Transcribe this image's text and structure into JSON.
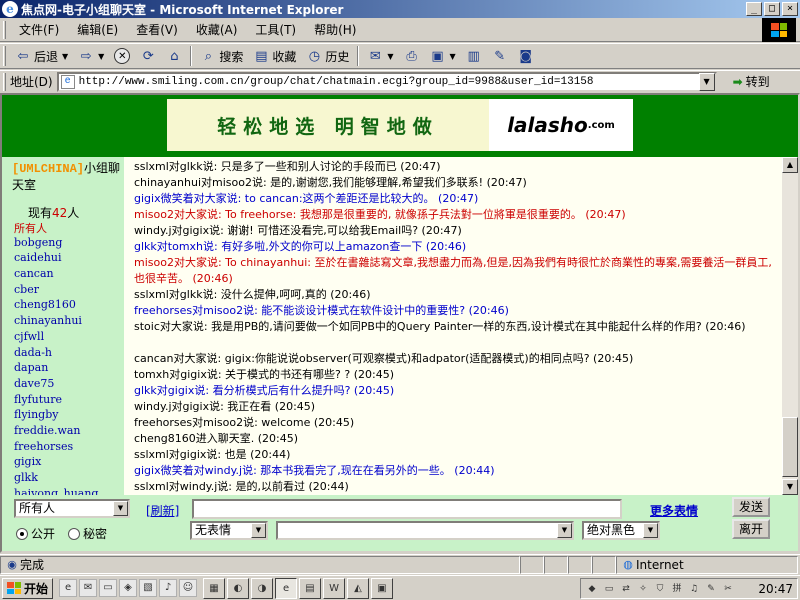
{
  "window": {
    "title": "焦点网-电子小组聊天室 - Microsoft Internet Explorer",
    "icon": "ie-icon",
    "controls": [
      "_",
      "□",
      "×"
    ]
  },
  "menu": [
    "文件(F)",
    "编辑(E)",
    "查看(V)",
    "收藏(A)",
    "工具(T)",
    "帮助(H)"
  ],
  "toolbar": {
    "back": "后退",
    "search": "搜索",
    "favorites": "收藏",
    "history": "历史"
  },
  "address": {
    "label": "地址(D)",
    "url": "http://www.smiling.com.cn/group/chat/chatmain.ecgi?group_id=9988&user_id=13158",
    "go": "转到"
  },
  "banner": {
    "slogan": "轻松地选 明智地做",
    "logo_main": "lalasho",
    "logo_suffix": ".com"
  },
  "room": {
    "brand": "[UMLCHINA]",
    "title_rest": "小组聊天室",
    "online_prefix": "现有",
    "online_count": "42",
    "online_suffix": "人"
  },
  "users": [
    "所有人",
    "bobgeng",
    "caidehui",
    "cancan",
    "cber",
    "cheng8160",
    "chinayanhui",
    "cjfwll",
    "dada-h",
    "dapan",
    "dave75",
    "flyfuture",
    "flyingby",
    "freddie.wan",
    "freehorses",
    "gigix",
    "glkk",
    "haiyong_huang"
  ],
  "colors": {
    "normal": "#000000",
    "blue": "#0000cc",
    "red": "#cc0000"
  },
  "messages": [
    {
      "text": "sslxml对glkk说: 只是多了一些和别人讨论的手段而已 (20:47)",
      "color": "normal"
    },
    {
      "text": "chinayanhui对misoo2说: 是的,谢谢您,我们能够理解,希望我们多联系!  (20:47)",
      "color": "normal"
    },
    {
      "text": "gigix微笑着对大家说: to cancan:这两个差距还是比较大的。 (20:47)",
      "color": "blue"
    },
    {
      "text": "misoo2对大家说: To freehorse: 我想那是很重要的, 就像孫子兵法對一位將軍是很重要的。 (20:47)",
      "color": "red"
    },
    {
      "text": "windy.j对gigix说: 谢谢! 可惜还没看完,可以给我Email吗? (20:47)",
      "color": "normal"
    },
    {
      "text": "glkk对tomxh说: 有好多啦,外文的你可以上amazon查一下 (20:46)",
      "color": "blue"
    },
    {
      "text": "misoo2对大家说: To chinayanhui: 至於在書雜誌寫文章,我想盡力而為,但是,因為我們有時很忙於商業性的專案,需要養活一群員工,也很辛苦。 (20:46)",
      "color": "red",
      "wrap": true
    },
    {
      "text": "sslxml对glkk说: 没什么提伸,呵呵,真的 (20:46)",
      "color": "normal"
    },
    {
      "text": "freehorses对misoo2说: 能不能谈设计模式在软件设计中的重要性? (20:46)",
      "color": "blue"
    },
    {
      "text": "stoic对大家说: 我是用PB的,请问要做一个如同PB中的Query Painter一样的东西,设计模式在其中能起什么样的作用? (20:46)",
      "color": "normal",
      "wrap": true
    },
    {
      "text": "cancan对大家说: gigix:你能说说observer(可观察模式)和adpator(适配器模式)的相同点吗? (20:45)",
      "color": "normal"
    },
    {
      "text": "tomxh对gigix说: 关于模式的书还有哪些? ? (20:45)",
      "color": "normal"
    },
    {
      "text": "glkk对gigix说: 看分析模式后有什么提升吗? (20:45)",
      "color": "blue"
    },
    {
      "text": "windy.j对gigix说: 我正在看 (20:45)",
      "color": "normal"
    },
    {
      "text": "freehorses对misoo2说: welcome (20:45)",
      "color": "normal"
    },
    {
      "text": "cheng8160进入聊天室. (20:45)",
      "color": "normal"
    },
    {
      "text": "sslxml对gigix说: 也是 (20:44)",
      "color": "normal"
    },
    {
      "text": "gigix微笑着对windy.j说: 那本书我看完了,现在在看另外的一些。 (20:44)",
      "color": "blue"
    },
    {
      "text": "sslxml对windy.j说: 是的,以前看过 (20:44)",
      "color": "normal"
    }
  ],
  "input": {
    "target": "所有人",
    "public": "公开",
    "private": "秘密",
    "refresh": "[刷新]",
    "expression": "无表情",
    "more_expressions": "更多表情",
    "send": "发送",
    "leave": "离开",
    "text_color": "绝对黑色"
  },
  "status": {
    "text": "完成",
    "zone": "Internet"
  },
  "taskbar": {
    "start": "开始",
    "clock": "20:47"
  }
}
